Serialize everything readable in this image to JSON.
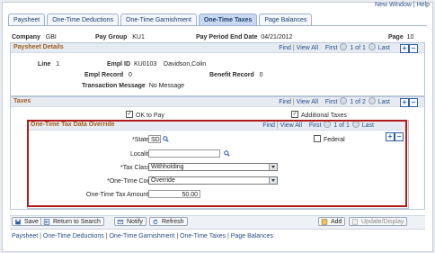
{
  "top_link": "New Window | Help",
  "tabs": [
    "Paysheet",
    "One-Time Deductions",
    "One-Time Garnishment",
    "One-Time Taxes",
    "Page Balances"
  ],
  "active_tab": "One-Time Taxes",
  "header": {
    "company_label": "Company",
    "company": "GBI",
    "paygroup_label": "Pay Group",
    "paygroup": "KU1",
    "pped_label": "Pay Period End Date",
    "pped": "04/21/2012",
    "page_label": "Page",
    "page": "10"
  },
  "paysheet": {
    "title": "Paysheet Details",
    "nav": {
      "find": "Find",
      "view_all": "View All",
      "first": "First",
      "counter": "1 of 1",
      "last": "Last"
    },
    "line_label": "Line",
    "line": "1",
    "emplid_label": "Empl ID",
    "emplid": "KU0103",
    "name": "Davidson,Colin",
    "empl_record_label": "Empl Record",
    "empl_record": "0",
    "benefit_record_label": "Benefit Record",
    "benefit_record": "0",
    "txn_label": "Transaction Message",
    "txn": "No Message"
  },
  "taxes": {
    "title": "Taxes",
    "nav": {
      "find": "Find",
      "view_all": "View All",
      "first": "First",
      "counter": "1 of 2",
      "last": "Last"
    },
    "ok_to_pay": "OK to Pay",
    "additional_taxes": "Additional Taxes"
  },
  "override": {
    "title": "One-Time Tax Data Override",
    "nav": {
      "find": "Find",
      "view_all": "View All",
      "first": "First",
      "counter": "1 of 1",
      "last": "Last"
    },
    "state_label": "*State",
    "state": "SD",
    "federal_label": "Federal",
    "locality_label": "Locality",
    "locality": "",
    "tax_class_label": "*Tax Class",
    "tax_class": "Withholding",
    "code_label": "*One-Time Code",
    "code": "Override",
    "amount_label": "One-Time Tax Amount",
    "amount": "50.00"
  },
  "buttons": {
    "save": "Save",
    "return": "Return to Search",
    "notify": "Notify",
    "refresh": "Refresh",
    "add": "Add",
    "update": "Update/Display"
  },
  "bottom_links": [
    "Paysheet",
    "One-Time Deductions",
    "One-Time Garnishment",
    "One-Time Taxes",
    "Page Balances"
  ],
  "colors": {
    "highlight_border": "#b21a1a",
    "section_title": "#a05a1a",
    "link": "#274e88"
  }
}
